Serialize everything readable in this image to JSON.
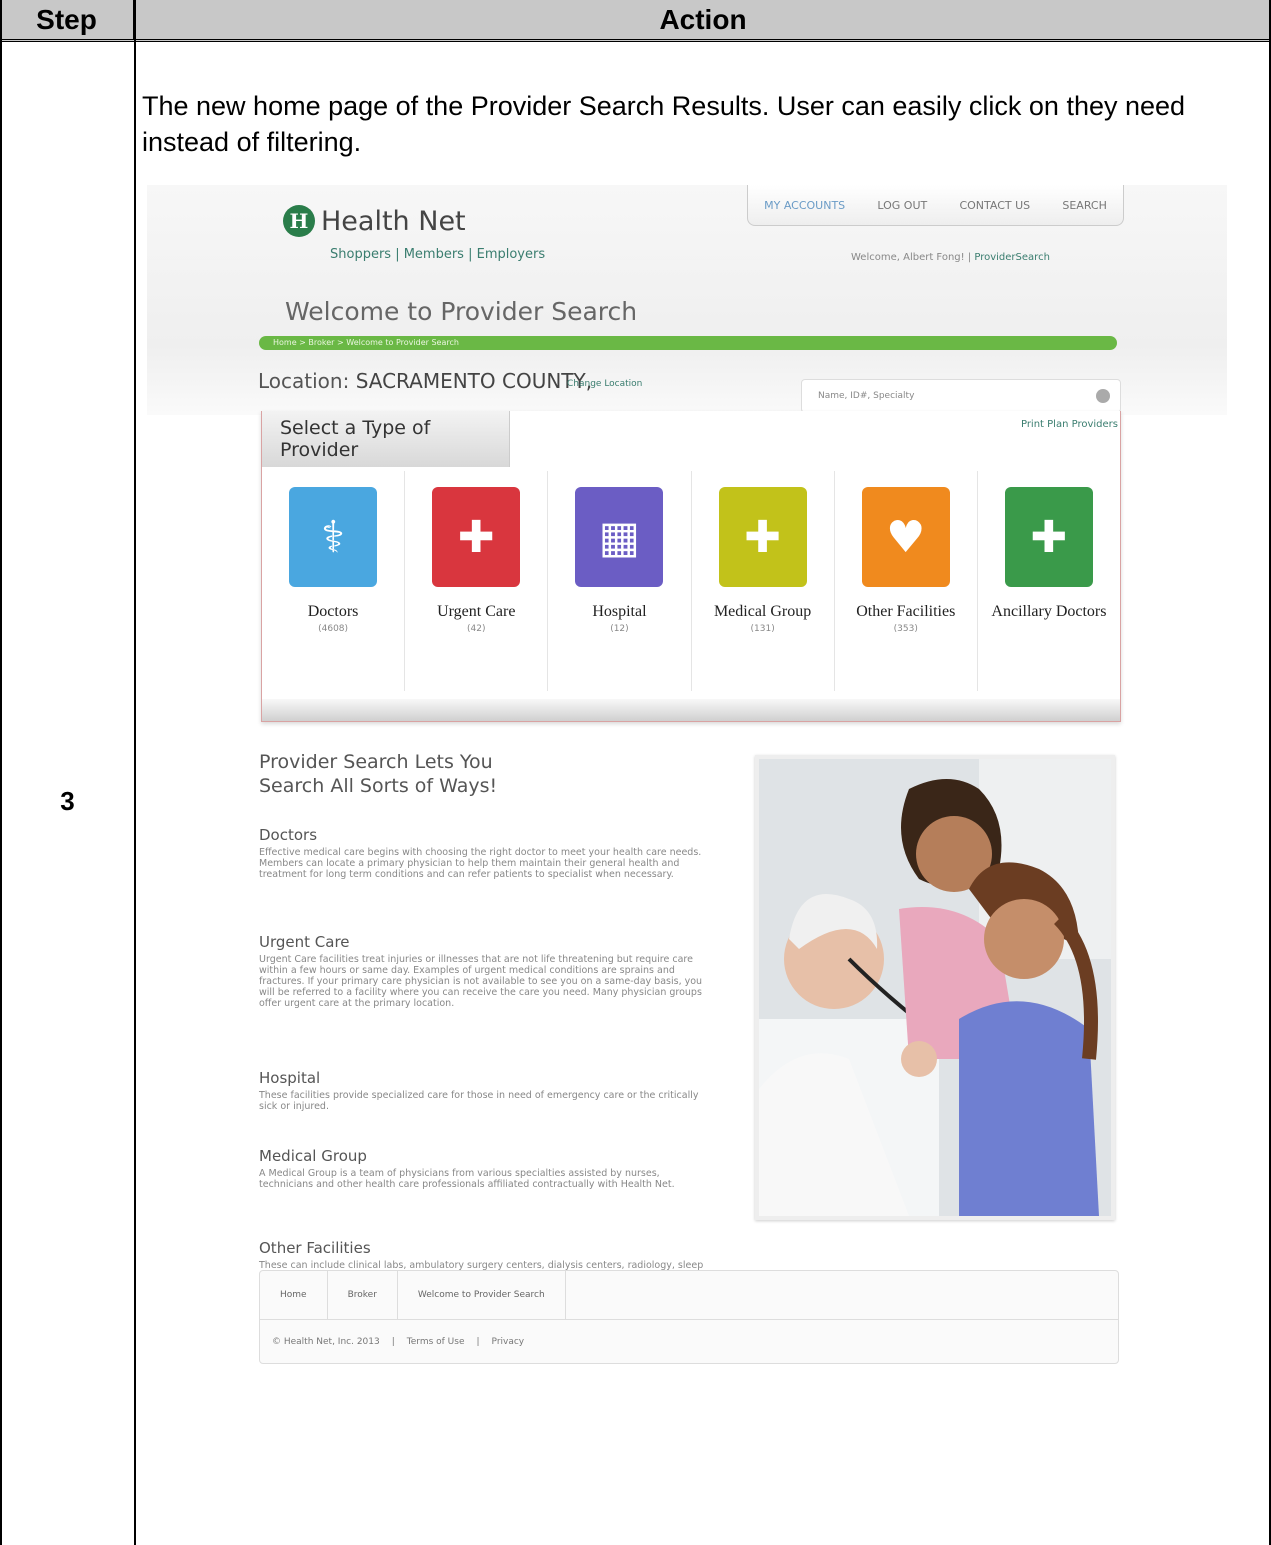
{
  "table": {
    "header_step": "Step",
    "header_action": "Action",
    "step_number": "3",
    "intro_text": "The new home page of the Provider Search Results. User can easily click on they need instead of filtering."
  },
  "site": {
    "logo_text": "Health Net",
    "logo_mark": "H",
    "audience_links": "Shoppers  |  Members  |  Employers",
    "top_nav": [
      "MY ACCOUNTS",
      "LOG OUT",
      "CONTACT US",
      "SEARCH"
    ],
    "welcome_user": "Welcome, Albert Fong! |",
    "provider_search_link": "ProviderSearch",
    "page_title": "Welcome to Provider Search",
    "breadcrumb_bar": "Home > Broker > Welcome to Provider Search",
    "location_label": "Location:",
    "location_value": "SACRAMENTO COUNTY,",
    "change_location": "Change Location",
    "search_placeholder": "Name, ID#, Specialty",
    "panel_title": "Select a Type of Provider",
    "print_link": "Print Plan Providers",
    "provider_types": [
      {
        "name": "Doctors",
        "count": "(4608)",
        "color": "#4aa7e0",
        "icon": "stethoscope-icon",
        "glyph": "⚕"
      },
      {
        "name": "Urgent Care",
        "count": "(42)",
        "color": "#d9363e",
        "icon": "ambulance-icon",
        "glyph": "✚"
      },
      {
        "name": "Hospital",
        "count": "(12)",
        "color": "#6b5dc4",
        "icon": "hospital-icon",
        "glyph": "▦"
      },
      {
        "name": "Medical Group",
        "count": "(131)",
        "color": "#c2c21a",
        "icon": "medical-kit-icon",
        "glyph": "✚"
      },
      {
        "name": "Other Facilities",
        "count": "(353)",
        "color": "#f08a1e",
        "icon": "heart-icon",
        "glyph": "♥"
      },
      {
        "name": "Ancillary Doctors",
        "count": "",
        "color": "#3a9a4a",
        "icon": "pill-bottle-icon",
        "glyph": "✚"
      }
    ],
    "lets_title_1": "Provider Search Lets You",
    "lets_title_2": "Search All Sorts of Ways!",
    "sections": [
      {
        "title": "Doctors",
        "body": "Effective medical care begins with choosing the right doctor to meet your health care needs. Members can locate a primary physician to help them maintain their general health and treatment for long term conditions and can refer patients to specialist when necessary."
      },
      {
        "title": "Urgent Care",
        "body": "Urgent Care facilities treat injuries or illnesses that are not life threatening but require care within a few hours or same day. Examples of urgent medical conditions are sprains and fractures. If your primary care physician is not available to see you on a same-day basis, you will be referred to a facility where you can receive the care you need. Many physician groups offer urgent care at the primary location."
      },
      {
        "title": "Hospital",
        "body": "These facilities provide specialized care for those in need of emergency care or the critically sick or injured."
      },
      {
        "title": "Medical Group",
        "body": "A Medical Group is a team of physicians from various specialties assisted by nurses, technicians and other health care professionals affiliated contractually with Health Net."
      },
      {
        "title": "Other Facilities",
        "body": "These can include clinical labs, ambulatory surgery centers, dialysis centers, radiology, sleep disorder clinics, skilled nursing, and more."
      }
    ],
    "footer_crumbs": [
      "Home",
      "Broker",
      "Welcome to Provider Search"
    ],
    "copyright": "© Health Net, Inc. 2013",
    "terms": "Terms of Use",
    "privacy": "Privacy",
    "separator": "|"
  }
}
